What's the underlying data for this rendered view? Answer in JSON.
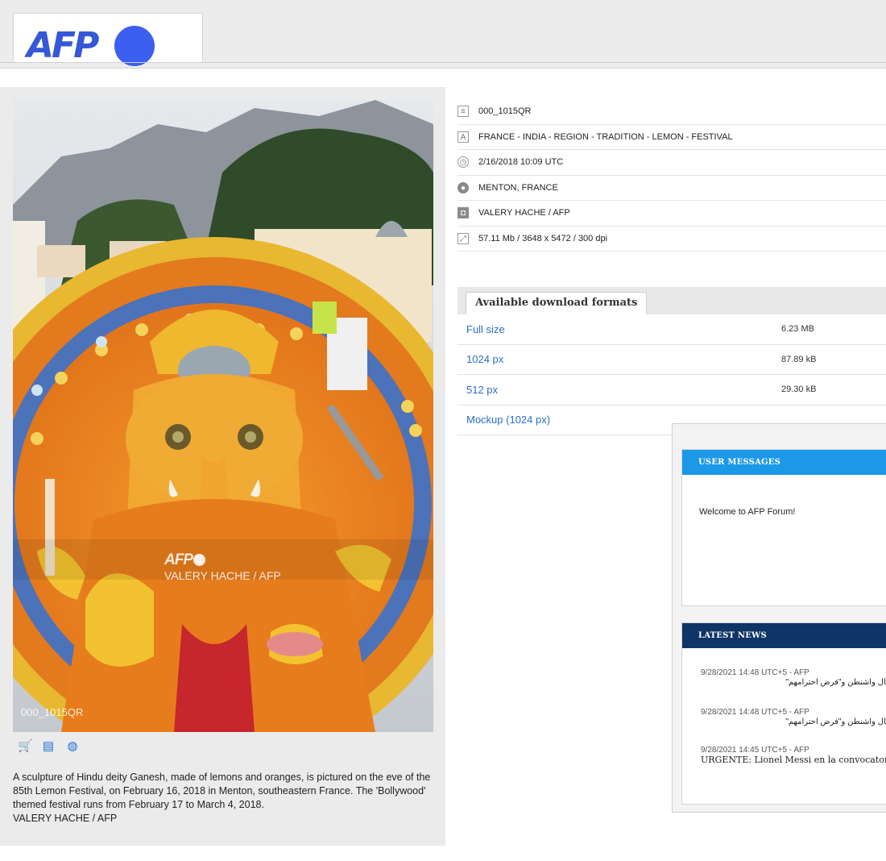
{
  "header": {
    "logo_text": "AFP"
  },
  "photo": {
    "watermark_logo": "AFP",
    "watermark_credit": "VALERY HACHE / AFP",
    "id_overlay": "000_1015QR",
    "action_icons": [
      "cart-icon",
      "print-icon",
      "globe-icon"
    ]
  },
  "caption": {
    "text": "A sculpture of Hindu deity Ganesh, made of lemons and oranges, is pictured on the eve of the 85th Lemon Festival, on February 16, 2018 in Menton, southeastern France. The 'Bollywood' themed festival runs from February 17 to March 4, 2018.",
    "credit": "VALERY HACHE / AFP"
  },
  "meta": {
    "id": "000_1015QR",
    "keywords": "FRANCE - INDIA - REGION - TRADITION - LEMON - FESTIVAL",
    "date": "2/16/2018 10:09 UTC",
    "location": "MENTON, FRANCE",
    "photographer": "VALERY HACHE / AFP",
    "file_info": "57.11 Mb / 3648 x 5472 / 300 dpi",
    "icons": [
      "document-icon",
      "letter-a-icon",
      "clock-icon",
      "globe-icon",
      "camera-icon",
      "resize-icon"
    ]
  },
  "formats": {
    "tab_label": "Available download formats",
    "items": [
      {
        "label": "Full size",
        "size": "6.23 MB"
      },
      {
        "label": "1024 px",
        "size": "87.89 kB"
      },
      {
        "label": "512 px",
        "size": "29.30 kB"
      },
      {
        "label": "Mockup (1024 px)",
        "size": ""
      }
    ]
  },
  "messages": {
    "title": "USER MESSAGES",
    "body": "Welcome to AFP Forum!"
  },
  "news": {
    "title": "LATEST NEWS",
    "items": [
      {
        "meta": "9/28/2021 14:48 UTC+5 - AFP",
        "headline": "احتيال واشنطن و\"فرض احترامهم\"",
        "dir": "rtl"
      },
      {
        "meta": "9/28/2021 14:48 UTC+5 - AFP",
        "headline": "احتيال واشنطن و\"فرض احترامهم\"",
        "dir": "rtl"
      },
      {
        "meta": "9/28/2021 14:45 UTC+5 - AFP",
        "headline": "URGENTE: Lionel Messi en la convocatoria",
        "dir": "ltr"
      }
    ]
  },
  "colors": {
    "link": "#2a6fc9",
    "messages_header": "#1c98e8",
    "news_header": "#0e3566",
    "logo": "#3558d8"
  }
}
